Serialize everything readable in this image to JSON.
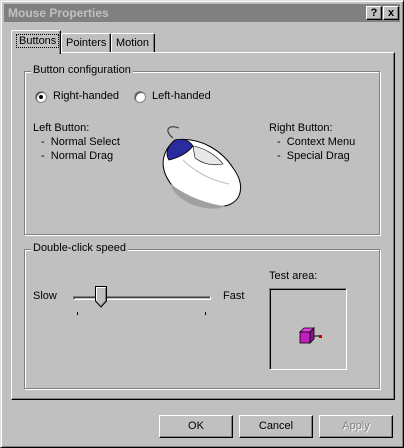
{
  "window": {
    "title": "Mouse Properties",
    "help_label": "?",
    "close_label": "x"
  },
  "tabs": [
    {
      "label": "Buttons",
      "active": true
    },
    {
      "label": "Pointers",
      "active": false
    },
    {
      "label": "Motion",
      "active": false
    }
  ],
  "button_config": {
    "group_title": "Button configuration",
    "right_handed_label": "Right-handed",
    "left_handed_label": "Left-handed",
    "selected": "right-handed",
    "left_button": {
      "heading": "Left Button:",
      "items": [
        "Normal Select",
        "Normal Drag"
      ]
    },
    "right_button": {
      "heading": "Right Button:",
      "items": [
        "Context Menu",
        "Special Drag"
      ]
    },
    "bullet": "-"
  },
  "double_click": {
    "group_title": "Double-click speed",
    "slow_label": "Slow",
    "fast_label": "Fast",
    "slider_value": 0.2,
    "test_area_label": "Test area:"
  },
  "footer": {
    "ok_label": "OK",
    "cancel_label": "Cancel",
    "apply_label": "Apply",
    "apply_enabled": false
  },
  "colors": {
    "face": "#c0c0c0",
    "mouse_button_accent": "#2b2ba0",
    "test_box": "#c020c0"
  }
}
